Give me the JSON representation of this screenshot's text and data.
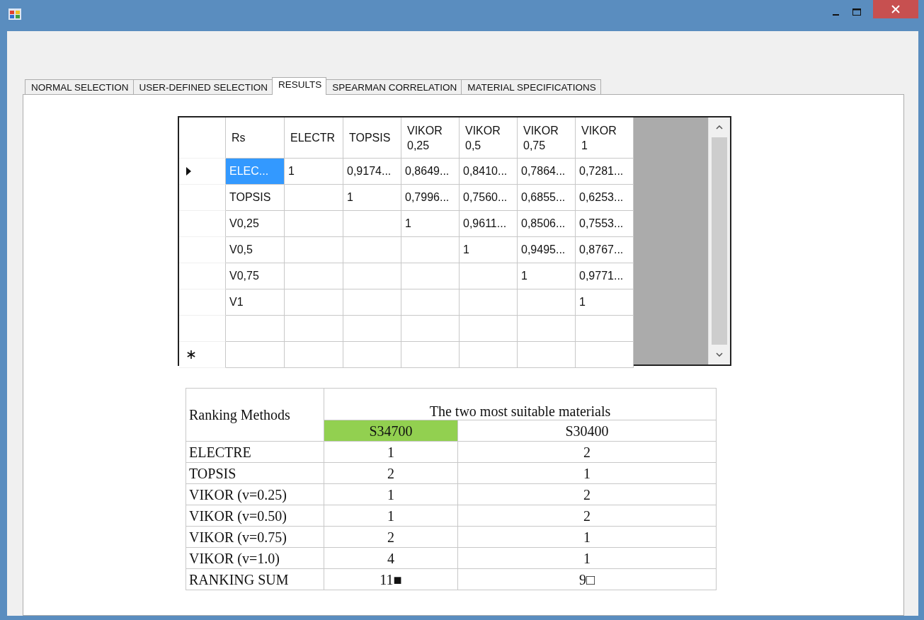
{
  "tabs": [
    {
      "label": "NORMAL SELECTION",
      "selected": false
    },
    {
      "label": "USER-DEFINED SELECTION",
      "selected": false
    },
    {
      "label": "RESULTS",
      "selected": true
    },
    {
      "label": "SPEARMAN CORRELATION",
      "selected": false
    },
    {
      "label": "MATERIAL SPECIFICATIONS",
      "selected": false
    }
  ],
  "grid": {
    "columns": [
      "Rs",
      "ELECTR",
      "TOPSIS",
      "VIKOR\n0,25",
      "VIKOR\n0,5",
      "VIKOR\n0,75",
      "VIKOR\n1"
    ],
    "rows": [
      {
        "kind": "data",
        "selected": true,
        "cells": [
          "ELEC...",
          "1",
          "0,9174...",
          "0,8649...",
          "0,8410...",
          "0,7864...",
          "0,7281..."
        ]
      },
      {
        "kind": "data",
        "selected": false,
        "cells": [
          "TOPSIS",
          null,
          "1",
          "0,7996...",
          "0,7560...",
          "0,6855...",
          "0,6253..."
        ]
      },
      {
        "kind": "data",
        "selected": false,
        "cells": [
          "V0,25",
          null,
          null,
          "1",
          "0,9611...",
          "0,8506...",
          "0,7553..."
        ]
      },
      {
        "kind": "data",
        "selected": false,
        "cells": [
          "V0,5",
          null,
          null,
          null,
          "1",
          "0,9495...",
          "0,8767..."
        ]
      },
      {
        "kind": "data",
        "selected": false,
        "cells": [
          "V0,75",
          null,
          null,
          null,
          null,
          "1",
          "0,9771..."
        ]
      },
      {
        "kind": "data",
        "selected": false,
        "cells": [
          "V1",
          null,
          null,
          null,
          null,
          null,
          "1"
        ]
      },
      {
        "kind": "blank",
        "selected": false
      },
      {
        "kind": "new",
        "selected": false
      }
    ]
  },
  "ranking": {
    "method_header": "Ranking Methods",
    "group_header": "The two most suitable materials",
    "materials": [
      {
        "name": "S34700",
        "highlighted": true
      },
      {
        "name": "S30400",
        "highlighted": false
      }
    ],
    "rows": [
      {
        "method": "ELECTRE",
        "values": [
          "1",
          "2"
        ]
      },
      {
        "method": "TOPSIS",
        "values": [
          "2",
          "1"
        ]
      },
      {
        "method": "VIKOR (v=0.25)",
        "values": [
          "1",
          "2"
        ]
      },
      {
        "method": "VIKOR (v=0.50)",
        "values": [
          "1",
          "2"
        ]
      },
      {
        "method": "VIKOR (v=0.75)",
        "values": [
          "2",
          "1"
        ]
      },
      {
        "method": "VIKOR (v=1.0)",
        "values": [
          "4",
          "1"
        ]
      },
      {
        "method": "RANKING SUM",
        "values": [
          "11■",
          "9□"
        ]
      }
    ]
  }
}
